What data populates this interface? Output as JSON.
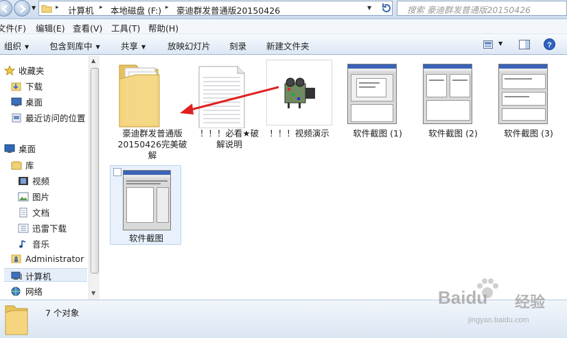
{
  "address": {
    "segments": [
      "计算机",
      "本地磁盘 (F:)",
      "豪迪群发普通版20150426"
    ],
    "search_placeholder": "搜索 豪迪群发普通版20150426"
  },
  "menu": [
    "文件(F)",
    "编辑(E)",
    "查看(V)",
    "工具(T)",
    "帮助(H)"
  ],
  "toolbar": {
    "organize": "组织",
    "include_in_library": "包含到库中",
    "share": "共享",
    "slideshow": "放映幻灯片",
    "burn": "刻录",
    "new_folder": "新建文件夹"
  },
  "nav": {
    "favorites": "收藏夹",
    "downloads": "下载",
    "desktop_fav": "桌面",
    "recent": "最近访问的位置",
    "desktop": "桌面",
    "libraries": "库",
    "videos": "视频",
    "pictures": "图片",
    "documents": "文档",
    "thunder": "迅雷下载",
    "music": "音乐",
    "admin": "Administrator",
    "computer": "计算机",
    "network": "网络"
  },
  "files": [
    {
      "name": "豪迪群发普通版\n20150426完美破\n解",
      "type": "folder"
    },
    {
      "name": "！！！必看★破\n解说明",
      "type": "text"
    },
    {
      "name": "！！！视频演示",
      "type": "video"
    },
    {
      "name": "软件截图 (1)",
      "type": "image"
    },
    {
      "name": "软件截图 (2)",
      "type": "image"
    },
    {
      "name": "软件截图 (3)",
      "type": "image"
    },
    {
      "name": "软件截图",
      "type": "image"
    }
  ],
  "status": {
    "count": "7 个对象"
  },
  "watermark": {
    "brand": "Baidu",
    "cn": "经验",
    "url": "jingyan.baidu.com"
  },
  "colors": {
    "arrow": "#e02020",
    "selection": "#e5eef9"
  }
}
